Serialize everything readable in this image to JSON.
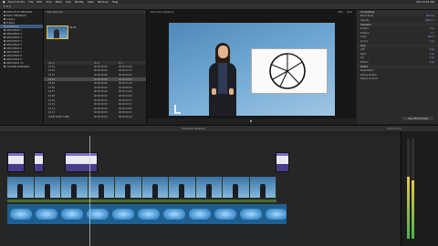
{
  "app": {
    "name": "Final Cut Pro"
  },
  "menubar": {
    "items": [
      "File",
      "Edit",
      "Trim",
      "Mark",
      "Clip",
      "Modify",
      "View",
      "Window",
      "Help"
    ],
    "right_items": [
      "Mon 8:15 AM"
    ]
  },
  "libraries": {
    "items": [
      {
        "label": "EXECUTIVE SPEAKING",
        "selected": false
      },
      {
        "label": "FIRST FEEDBACK",
        "selected": false
      },
      {
        "label": "A-ROLL",
        "selected": false
      },
      {
        "label": "B-ROLL",
        "selected": false
      },
      {
        "label": "GRAPHICS",
        "selected": true
      },
      {
        "label": "SEQUENCE 1",
        "selected": false
      },
      {
        "label": "SEQUENCE 2",
        "selected": false
      },
      {
        "label": "SEQUENCE 3",
        "selected": false
      },
      {
        "label": "SEQUENCE 4",
        "selected": false
      },
      {
        "label": "SEQUENCE 5",
        "selected": false
      },
      {
        "label": "SEQUENCE 6",
        "selected": false
      },
      {
        "label": "SEQUENCE 7",
        "selected": false
      },
      {
        "label": "SEQUENCE 8",
        "selected": false
      },
      {
        "label": "SEQUENCE 9",
        "selected": false
      },
      {
        "label": "SEQUENCE 10",
        "selected": false
      },
      {
        "label": "CLOSING REMARKS",
        "selected": false
      }
    ]
  },
  "browser": {
    "header": "Hide Rejected",
    "clip_title": "01-01",
    "columns": [
      "Name",
      "Start",
      "End"
    ],
    "rows": [
      {
        "name": "01 01",
        "start": "00:00:00:00",
        "end": "00:00:15:08",
        "selected": false
      },
      {
        "name": "01 02",
        "start": "00:00:00:00",
        "end": "00:00:12:11",
        "selected": false
      },
      {
        "name": "01 03",
        "start": "00:00:00:00",
        "end": "00:00:09:22",
        "selected": false
      },
      {
        "name": "01 04",
        "start": "00:00:00:00",
        "end": "00:00:20:01",
        "selected": true
      },
      {
        "name": "01 05",
        "start": "00:00:00:00",
        "end": "00:00:11:16",
        "selected": false
      },
      {
        "name": "01 06",
        "start": "00:00:00:00",
        "end": "00:00:08:04",
        "selected": false
      },
      {
        "name": "01 07",
        "start": "00:00:00:00",
        "end": "00:00:14:19",
        "selected": false
      },
      {
        "name": "01 08",
        "start": "00:00:00:00",
        "end": "00:00:10:02",
        "selected": false
      },
      {
        "name": "01 09",
        "start": "00:00:00:00",
        "end": "00:00:16:27",
        "selected": false
      },
      {
        "name": "01 10",
        "start": "00:00:00:00",
        "end": "00:00:07:13",
        "selected": false
      },
      {
        "name": "01 11",
        "start": "00:00:00:00",
        "end": "00:00:13:05",
        "selected": false
      },
      {
        "name": "01 12",
        "start": "00:00:00:00",
        "end": "00:00:18:21",
        "selected": false
      },
      {
        "name": "CODE SELECT LINE",
        "start": "00:00:00:00",
        "end": "00:00:06:14",
        "selected": false
      }
    ]
  },
  "viewer": {
    "header": "Executive Speaking",
    "zoom": "56%",
    "view": "View"
  },
  "inspector": {
    "rows": [
      {
        "label": "Compositing",
        "value": "",
        "section": true
      },
      {
        "label": "Blend Mode",
        "value": "Normal"
      },
      {
        "label": "Opacity",
        "value": "100.0 %"
      },
      {
        "label": "Transform",
        "value": "",
        "section": true
      },
      {
        "label": "Position",
        "value": "0 px"
      },
      {
        "label": "Rotation",
        "value": "0 °"
      },
      {
        "label": "Scale",
        "value": "100 %"
      },
      {
        "label": "Anchor",
        "value": "0 px"
      },
      {
        "label": "Crop",
        "value": "",
        "section": true
      },
      {
        "label": "Left",
        "value": "0 px"
      },
      {
        "label": "Right",
        "value": "0 px"
      },
      {
        "label": "Top",
        "value": "0 px"
      },
      {
        "label": "Bottom",
        "value": "0 px"
      },
      {
        "label": "Distort",
        "value": "",
        "section": true
      },
      {
        "label": "Stabilization",
        "value": ""
      },
      {
        "label": "Rolling Shutter",
        "value": ""
      },
      {
        "label": "Spatial Conform",
        "value": ""
      }
    ],
    "save_button": "Save Effects Preset"
  },
  "timeline": {
    "header": "Executive Speaking",
    "timecode": "00:00:19:14"
  },
  "meters": {
    "levels": [
      0.62,
      0.58
    ]
  }
}
